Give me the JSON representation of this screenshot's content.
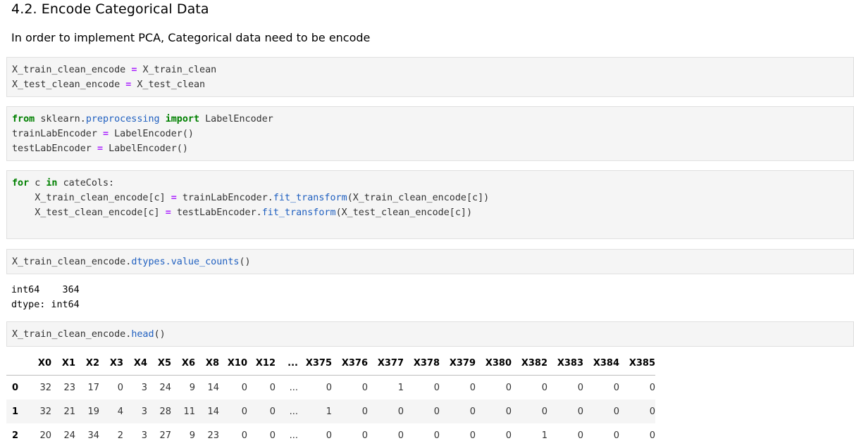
{
  "heading": "4.2. Encode Categorical Data",
  "paragraph": "In order to implement PCA, Categorical data need to be encode",
  "cell1": {
    "line1": {
      "a": "X_train_clean_encode",
      "op": "=",
      "b": "X_train_clean"
    },
    "line2": {
      "a": "X_test_clean_encode",
      "op": "=",
      "b": "X_test_clean"
    }
  },
  "cell2": {
    "from": "from",
    "module_a": "sklearn.",
    "module_b": "preprocessing",
    "import": "import",
    "name": "LabelEncoder",
    "line2": {
      "a": "trainLabEncoder",
      "op": "=",
      "b": "LabelEncoder()"
    },
    "line3": {
      "a": "testLabEncoder",
      "op": "=",
      "b": "LabelEncoder()"
    }
  },
  "cell3": {
    "for": "for",
    "var": "c",
    "in": "in",
    "iter": "cateCols:",
    "line2": {
      "a": "X_train_clean_encode[c]",
      "op": "=",
      "b": "trainLabEncoder.",
      "fn": "fit_transform",
      "c": "(X_train_clean_encode[c])"
    },
    "line3": {
      "a": "X_test_clean_encode[c]",
      "op": "=",
      "b": "testLabEncoder.",
      "fn": "fit_transform",
      "c": "(X_test_clean_encode[c])"
    }
  },
  "cell4": {
    "a": "X_train_clean_encode.",
    "fn": "dtypes.value_counts",
    "b": "()"
  },
  "output4": {
    "line1": "int64    364",
    "line2": "dtype: int64"
  },
  "cell5": {
    "a": "X_train_clean_encode.",
    "fn": "head",
    "b": "()"
  },
  "table": {
    "columns": [
      "X0",
      "X1",
      "X2",
      "X3",
      "X4",
      "X5",
      "X6",
      "X8",
      "X10",
      "X12",
      "...",
      "X375",
      "X376",
      "X377",
      "X378",
      "X379",
      "X380",
      "X382",
      "X383",
      "X384",
      "X385"
    ],
    "rows": [
      {
        "index": "0",
        "cells": [
          "32",
          "23",
          "17",
          "0",
          "3",
          "24",
          "9",
          "14",
          "0",
          "0",
          "...",
          "0",
          "0",
          "1",
          "0",
          "0",
          "0",
          "0",
          "0",
          "0",
          "0"
        ]
      },
      {
        "index": "1",
        "cells": [
          "32",
          "21",
          "19",
          "4",
          "3",
          "28",
          "11",
          "14",
          "0",
          "0",
          "...",
          "1",
          "0",
          "0",
          "0",
          "0",
          "0",
          "0",
          "0",
          "0",
          "0"
        ]
      },
      {
        "index": "2",
        "cells": [
          "20",
          "24",
          "34",
          "2",
          "3",
          "27",
          "9",
          "23",
          "0",
          "0",
          "...",
          "0",
          "0",
          "0",
          "0",
          "0",
          "0",
          "1",
          "0",
          "0",
          "0"
        ]
      }
    ]
  }
}
